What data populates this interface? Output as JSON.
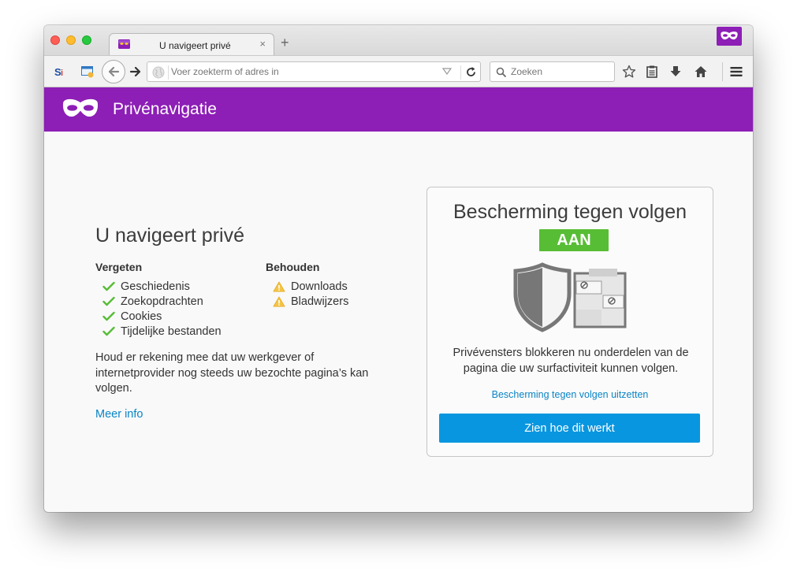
{
  "window": {
    "tab_title": "U navigeert privé",
    "tab_close_glyph": "×",
    "new_tab_glyph": "+"
  },
  "toolbar": {
    "url_placeholder": "Voer zoekterm of adres in",
    "search_placeholder": "Zoeken"
  },
  "header": {
    "title": "Privénavigatie",
    "color": "#8d1eb6"
  },
  "main": {
    "title": "U navigeert privé",
    "forget": {
      "heading": "Vergeten",
      "items": [
        "Geschiedenis",
        "Zoekopdrachten",
        "Cookies",
        "Tijdelijke bestanden"
      ]
    },
    "keep": {
      "heading": "Behouden",
      "items": [
        "Downloads",
        "Bladwijzers"
      ]
    },
    "note": "Houd er rekening mee dat uw werkgever of internetprovider nog steeds uw bezochte pagina’s kan volgen.",
    "more_info": "Meer info"
  },
  "tracking": {
    "title": "Bescherming tegen volgen",
    "status": "AAN",
    "status_color": "#57bd35",
    "description": "Privévensters blokkeren nu onderdelen van de pagina die uw surfactiviteit kunnen volgen.",
    "disable_link": "Bescherming tegen volgen uitzetten",
    "learn_button": "Zien hoe dit werkt",
    "button_color": "#0996e0",
    "link_color": "#0a84c5"
  },
  "icons": {
    "check": "check-icon",
    "warning": "warning-icon",
    "mask": "private-mask-icon",
    "shield": "shield-icon"
  }
}
